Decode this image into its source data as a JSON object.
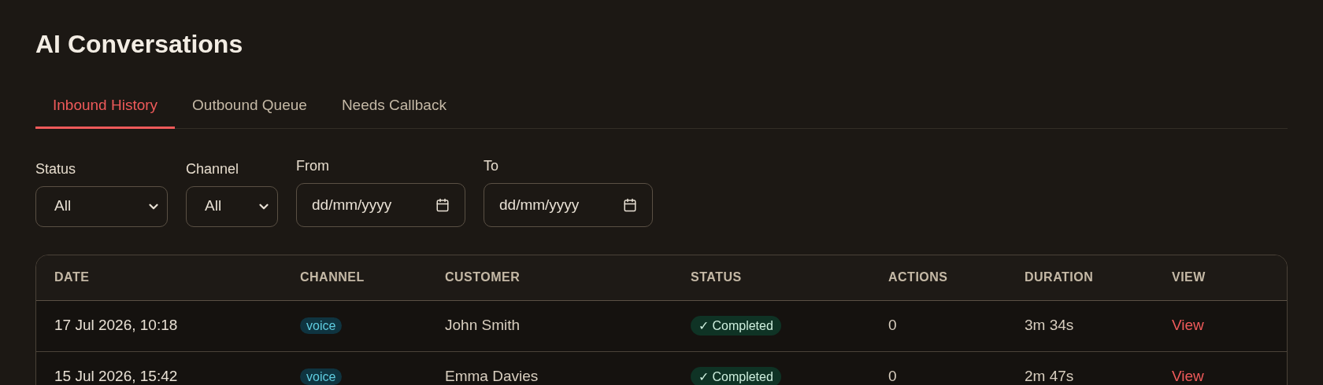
{
  "title": "AI Conversations",
  "tabs": [
    {
      "label": "Inbound History",
      "selected": true
    },
    {
      "label": "Outbound Queue",
      "selected": false
    },
    {
      "label": "Needs Callback",
      "selected": false
    }
  ],
  "filters": [
    {
      "kind": "select",
      "label": "Status",
      "value": "All"
    },
    {
      "kind": "select",
      "label": "Channel",
      "value": "All"
    },
    {
      "kind": "date",
      "label": "From",
      "placeholder": "dd/mm/yyyy"
    },
    {
      "kind": "date",
      "label": "To",
      "placeholder": "dd/mm/yyyy"
    }
  ],
  "table": {
    "columns": [
      "DATE",
      "CHANNEL",
      "CUSTOMER",
      "STATUS",
      "ACTIONS",
      "DURATION",
      "VIEW"
    ],
    "rows": [
      {
        "date": "17 Jul 2026, 10:18",
        "channel": "voice",
        "customer": "John Smith",
        "status": {
          "kind": "completed",
          "label": "✓ Completed"
        },
        "actions": "0",
        "duration": "3m 34s",
        "view": "View"
      },
      {
        "date": "15 Jul 2026, 15:42",
        "channel": "voice",
        "customer": "Emma Davies",
        "status": {
          "kind": "completed",
          "label": "✓ Completed"
        },
        "actions": "0",
        "duration": "2m 47s",
        "view": "View"
      }
    ]
  }
}
